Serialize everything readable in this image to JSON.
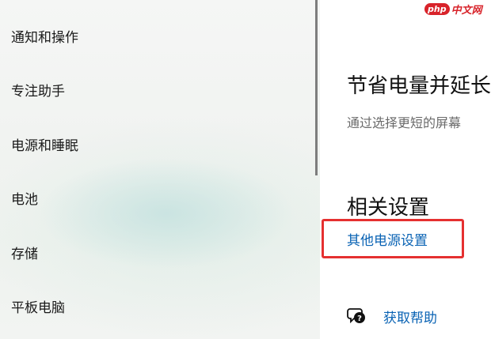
{
  "sidebar": {
    "items": [
      {
        "label": "通知和操作"
      },
      {
        "label": "专注助手"
      },
      {
        "label": "电源和睡眠"
      },
      {
        "label": "电池"
      },
      {
        "label": "存储"
      },
      {
        "label": "平板电脑"
      }
    ]
  },
  "main": {
    "section_title": "节省电量并延长",
    "section_desc": "通过选择更短的屏幕",
    "related_title": "相关设置",
    "power_link": "其他电源设置",
    "help_label": "获取帮助"
  },
  "watermark": {
    "badge": "php",
    "text": "中文网"
  },
  "colors": {
    "accent_link": "#0a63b4",
    "highlight_box": "#e53030",
    "watermark": "#d8232a"
  },
  "icons": {
    "help": "question-chat-icon"
  }
}
